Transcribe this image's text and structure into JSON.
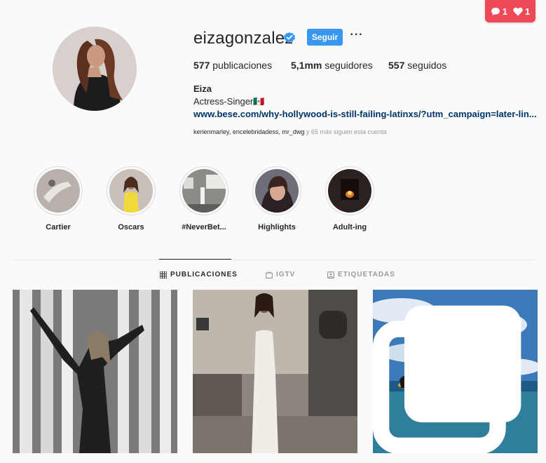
{
  "notifications": {
    "comments": "1",
    "likes": "1"
  },
  "profile": {
    "username": "eizagonzalez",
    "follow_label": "Seguir",
    "more_label": "···",
    "stats": [
      {
        "count": "577",
        "label": "publicaciones"
      },
      {
        "count": "5,1mm",
        "label": "seguidores"
      },
      {
        "count": "557",
        "label": "seguidos"
      }
    ],
    "full_name": "Eiza",
    "bio": "Actress-Singer🇲🇽",
    "link": "www.bese.com/why-hollywood-is-still-failing-latinxs/?utm_campaign=later-lin...",
    "followed_by_names": "kerienmarley, encelebridadess, mr_dwg",
    "followed_by_rest": " y 65 más siguen esta cuenta"
  },
  "highlights": [
    {
      "label": "Cartier"
    },
    {
      "label": "Oscars"
    },
    {
      "label": "#NeverBet..."
    },
    {
      "label": "Highlights"
    },
    {
      "label": "Adult-ing"
    }
  ],
  "tabs": [
    {
      "label": "PUBLICACIONES",
      "icon": "grid-icon",
      "active": true
    },
    {
      "label": "IGTV",
      "icon": "tv-icon",
      "active": false
    },
    {
      "label": "ETIQUETADAS",
      "icon": "tagged-icon",
      "active": false
    }
  ],
  "colors": {
    "accent": "#3897f0",
    "notification": "#ed4956",
    "link": "#003569",
    "verified": "#3897f0"
  }
}
